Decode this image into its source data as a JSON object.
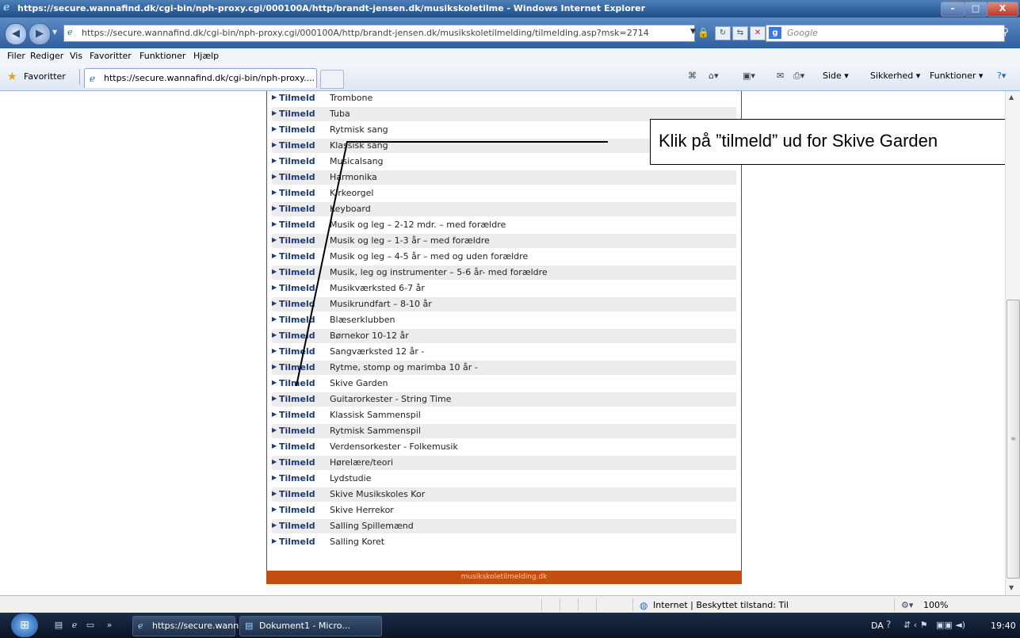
{
  "window": {
    "title": "https://secure.wannafind.dk/cgi-bin/nph-proxy.cgi/000100A/http/brandt-jensen.dk/musikskoletilme - Windows Internet Explorer",
    "min": "–",
    "max": "□",
    "close": "X"
  },
  "address": {
    "url": "https://secure.wannafind.dk/cgi-bin/nph-proxy.cgi/000100A/http/brandt-jensen.dk/musikskoletilmelding/tilmelding.asp?msk=2714",
    "search_placeholder": "Google"
  },
  "menu": [
    "Filer",
    "Rediger",
    "Vis",
    "Favoritter",
    "Funktioner",
    "Hjælp"
  ],
  "favbar": {
    "favorites_label": "Favoritter",
    "tab_label": "https://secure.wannafind.dk/cgi-bin/nph-proxy....",
    "side": "Side ▾",
    "sikkerhed": "Sikkerhed ▾",
    "funktioner": "Funktioner ▾"
  },
  "list": {
    "link_label": "Tilmeld",
    "items": [
      "Trombone",
      "Tuba",
      "Rytmisk sang",
      "Klassisk sang",
      "Musicalsang",
      "Harmonika",
      "Kirkeorgel",
      "Keyboard",
      "Musik og leg – 2-12 mdr. – med forældre",
      "Musik og leg – 1-3 år – med forældre",
      "Musik og leg – 4-5 år – med og uden forældre",
      "Musik, leg og instrumenter – 5-6 år- med forældre",
      "Musikværksted 6-7 år",
      "Musikrundfart – 8-10 år",
      "Blæserklubben",
      "Børnekor 10-12 år",
      "Sangværksted 12 år -",
      "Rytme, stomp og marimba 10 år -",
      "Skive Garden",
      "Guitarorkester - String Time",
      "Klassisk Sammenspil",
      "Rytmisk Sammenspil",
      "Verdensorkester - Folkemusik",
      "Hørelære/teori",
      "Lydstudie",
      "Skive Musikskoles Kor",
      "Skive Herrekor",
      "Salling Spillemænd",
      "Salling Koret"
    ],
    "footer": "musikskoletilmelding.dk"
  },
  "annotation": "Klik på ”tilmeld” ud for Skive Garden",
  "status": {
    "zone": "Internet | Beskyttet tilstand: Til",
    "zoom": "100%"
  },
  "taskbar": {
    "ie_task": "https://secure.wann...",
    "word_task": "Dokument1 - Micro...",
    "lang": "DA",
    "time": "19:40"
  }
}
